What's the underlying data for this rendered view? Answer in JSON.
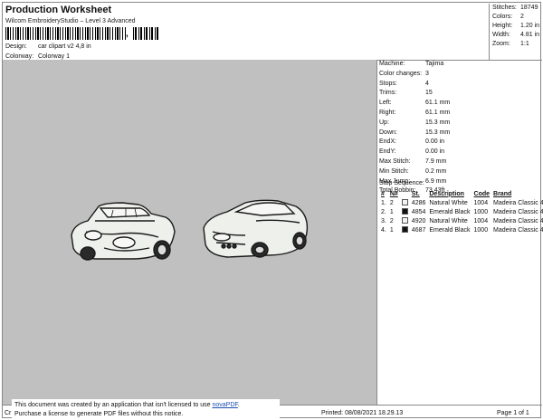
{
  "header": {
    "title": "Production Worksheet",
    "subtitle": "Wilcom EmbroideryStudio – Level 3 Advanced",
    "design_label": "Design:",
    "design_value": "car clipart v2 4,8 in",
    "colorway_label": "Colorway:",
    "colorway_value": "Colorway 1"
  },
  "summary": [
    {
      "label": "Stitches:",
      "value": "18749"
    },
    {
      "label": "Colors:",
      "value": "2"
    },
    {
      "label": "Height:",
      "value": "1.20 in"
    },
    {
      "label": "Width:",
      "value": "4.81 in"
    },
    {
      "label": "Zoom:",
      "value": "1:1"
    }
  ],
  "machine_info": [
    {
      "label": "Machine:",
      "value": "Tajima"
    },
    {
      "label": "Color changes:",
      "value": "3"
    },
    {
      "label": "Stops:",
      "value": "4"
    },
    {
      "label": "Trims:",
      "value": "15"
    },
    {
      "label": "Left:",
      "value": "61.1 mm"
    },
    {
      "label": "Right:",
      "value": "61.1 mm"
    },
    {
      "label": "Up:",
      "value": "15.3 mm"
    },
    {
      "label": "Down:",
      "value": "15.3 mm"
    },
    {
      "label": "EndX:",
      "value": "0.00 in"
    },
    {
      "label": "EndY:",
      "value": "0.00 in"
    },
    {
      "label": "Max Stitch:",
      "value": "7.9 mm"
    },
    {
      "label": "Min Stitch:",
      "value": "0.2 mm"
    },
    {
      "label": "Max Jump:",
      "value": "6.9 mm"
    },
    {
      "label": "Total Bobbin:",
      "value": "73.43ft"
    }
  ],
  "stop_sequence": {
    "title": "Stop Sequence:",
    "headers": [
      "#",
      "N#",
      "St.",
      "Description",
      "Code",
      "Brand"
    ],
    "rows": [
      {
        "num": "1.",
        "n": "2",
        "color": "#f2f2f2",
        "st": "4286",
        "desc": "Natural White",
        "code": "1004",
        "brand": "Madeira Classic 40"
      },
      {
        "num": "2.",
        "n": "1",
        "color": "#111111",
        "st": "4854",
        "desc": "Emerald Black",
        "code": "1000",
        "brand": "Madeira Classic 40"
      },
      {
        "num": "3.",
        "n": "2",
        "color": "#f2f2f2",
        "st": "4920",
        "desc": "Natural White",
        "code": "1004",
        "brand": "Madeira Classic 40"
      },
      {
        "num": "4.",
        "n": "1",
        "color": "#111111",
        "st": "4687",
        "desc": "Emerald Black",
        "code": "1000",
        "brand": "Madeira Classic 40"
      }
    ]
  },
  "notice": {
    "line1_pre": "This document was created by an application that isn't licensed to use ",
    "link": "novaPDF",
    "line1_post": ".",
    "line2": "Purchase a license to generate PDF files without this notice."
  },
  "footer": {
    "left": "Cr",
    "printed": "Printed: 08/08/2021 18.29.13",
    "page": "Page 1 of 1"
  },
  "colors": {
    "canvas_bg": "#c0c0c0",
    "thread_white": "#f2f2f2",
    "thread_black": "#111111"
  }
}
